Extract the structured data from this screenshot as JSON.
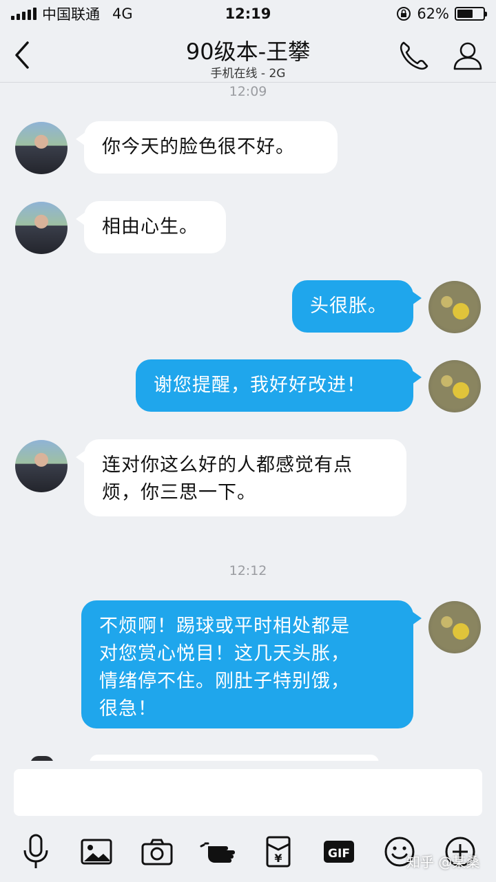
{
  "status_bar": {
    "carrier": "中国联通",
    "network": "4G",
    "time": "12:19",
    "battery_text": "62%",
    "battery_level": 0.62
  },
  "header": {
    "title": "90级本-王攀",
    "subtitle": "手机在线 - 2G"
  },
  "messages": {
    "ts1": "12:09",
    "m1": "你今天的脸色很不好。",
    "m2": "相由心生。",
    "m3": "头很胀。",
    "m4": "谢您提醒，我好好改进！",
    "m5_line1": "连对你这么好的人都感觉有点",
    "m5_line2": "烦，你三思一下。",
    "ts2": "12:12",
    "m6_line1": "不烦啊！踢球或平时相处都是",
    "m6_line2": "对您赏心悦目！这几天头胀，",
    "m6_line3": "情绪停不住。刚肚子特别饿，",
    "m6_line4": "很急！"
  },
  "input": {
    "placeholder": ""
  },
  "toolbar": {
    "gif_label": "GIF",
    "redpacket_symbol": "¥"
  },
  "watermark": "知乎 @某桑",
  "colors": {
    "background": "#eef0f3",
    "self_bubble": "#1fa6ec",
    "friend_bubble": "#ffffff"
  }
}
